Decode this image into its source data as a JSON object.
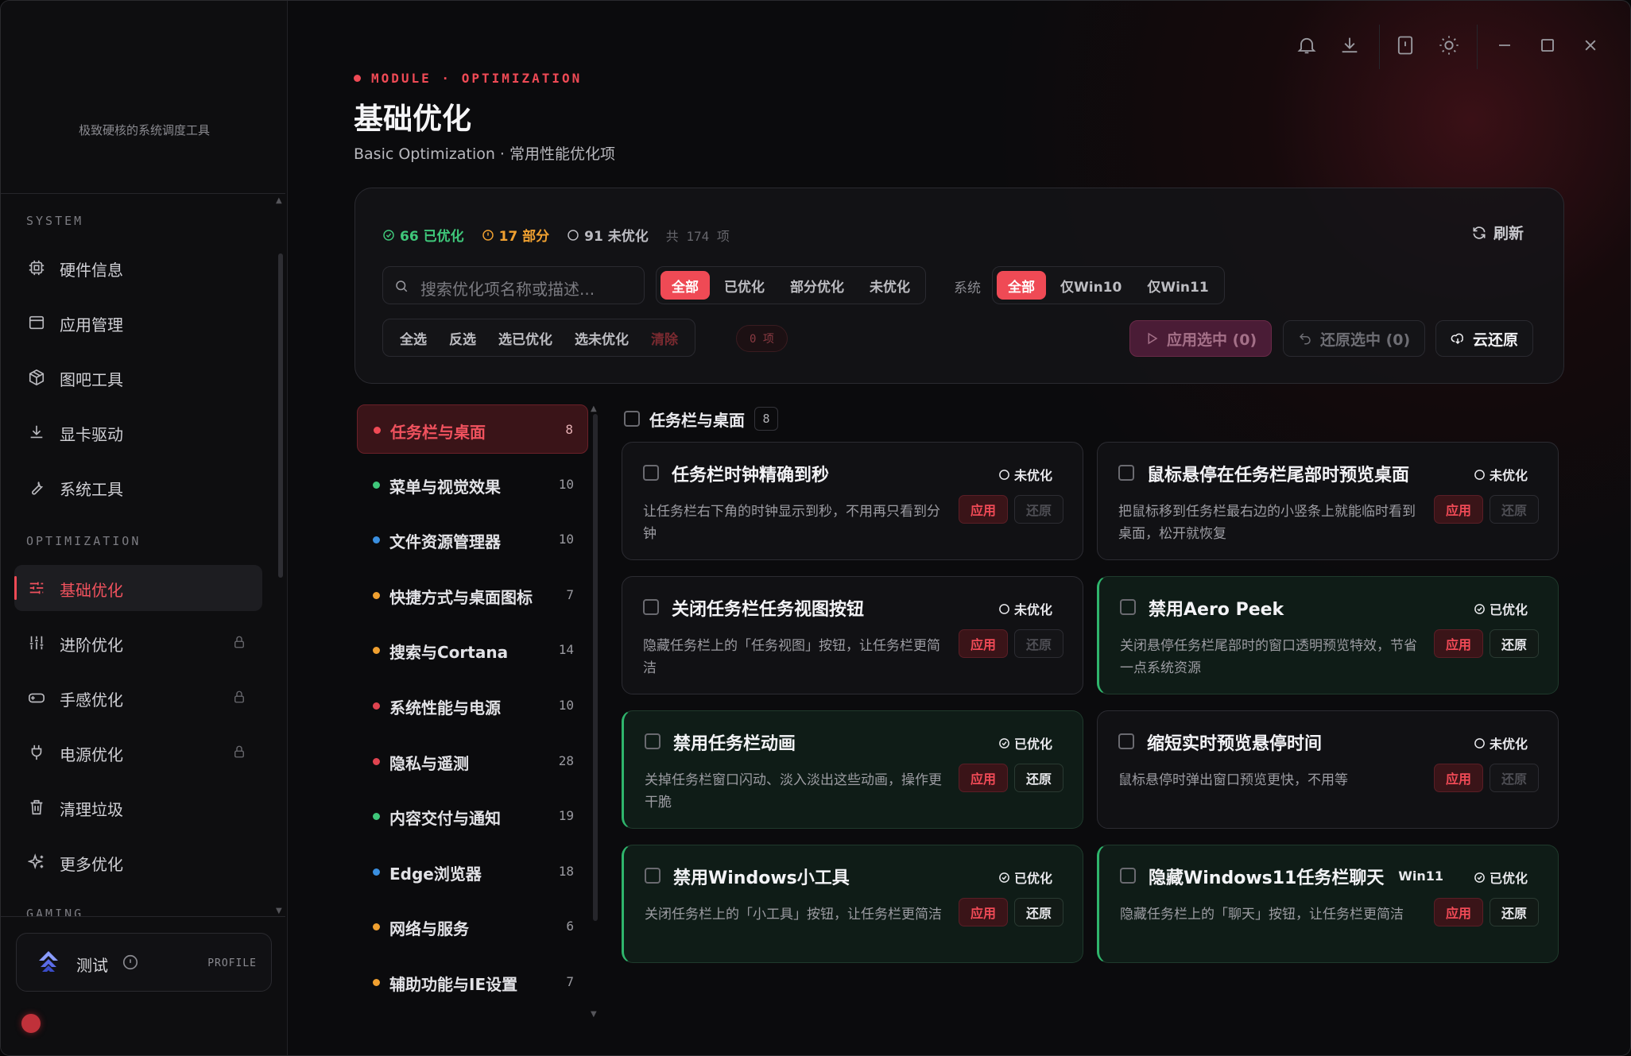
{
  "sidebar": {
    "tagline": "极致硬核的系统调度工具",
    "sections": {
      "system": "SYSTEM",
      "optimization": "OPTIMIZATION",
      "gaming": "GAMING"
    },
    "items": [
      {
        "label": "硬件信息",
        "icon": "cpu-icon"
      },
      {
        "label": "应用管理",
        "icon": "window-icon"
      },
      {
        "label": "图吧工具",
        "icon": "package-icon"
      },
      {
        "label": "显卡驱动",
        "icon": "download-icon"
      },
      {
        "label": "系统工具",
        "icon": "wrench-icon"
      },
      {
        "label": "基础优化",
        "icon": "sliders-icon",
        "active": true
      },
      {
        "label": "进阶优化",
        "icon": "sliders-vertical-icon",
        "locked": true
      },
      {
        "label": "手感优化",
        "icon": "gamepad-icon",
        "locked": true
      },
      {
        "label": "电源优化",
        "icon": "plug-icon",
        "locked": true
      },
      {
        "label": "清理垃圾",
        "icon": "trash-icon"
      },
      {
        "label": "更多优化",
        "icon": "sparkles-icon"
      }
    ],
    "profile": {
      "name": "测试",
      "tag": "PROFILE"
    }
  },
  "header": {
    "module": "MODULE · OPTIMIZATION",
    "title": "基础优化",
    "subtitle": "Basic Optimization · 常用性能优化项"
  },
  "stats": {
    "optimized": "66 已优化",
    "partial": "17 部分",
    "unoptimized": "91 未优化",
    "total": "共 174 项"
  },
  "toolbar": {
    "refresh": "刷新",
    "search_placeholder": "搜索优化项名称或描述...",
    "status_filters": [
      "全部",
      "已优化",
      "部分优化",
      "未优化"
    ],
    "system_label": "系统",
    "system_filters": [
      "全部",
      "仅Win10",
      "仅Win11"
    ],
    "select_actions": [
      "全选",
      "反选",
      "选已优化",
      "选未优化",
      "清除"
    ],
    "selected_count": "0 项",
    "apply_selected": "应用选中 (0)",
    "restore_selected": "还原选中 (0)",
    "cloud_restore": "云还原"
  },
  "categories": [
    {
      "name": "任务栏与桌面",
      "count": "8",
      "color": "#ef4a55",
      "active": true
    },
    {
      "name": "菜单与视觉效果",
      "count": "10",
      "color": "#3fc77a"
    },
    {
      "name": "文件资源管理器",
      "count": "10",
      "color": "#3a8fe0"
    },
    {
      "name": "快捷方式与桌面图标",
      "count": "7",
      "color": "#f0a030"
    },
    {
      "name": "搜索与Cortana",
      "count": "14",
      "color": "#f0a030"
    },
    {
      "name": "系统性能与电源",
      "count": "10",
      "color": "#e04450"
    },
    {
      "name": "隐私与遥测",
      "count": "28",
      "color": "#e04450"
    },
    {
      "name": "内容交付与通知",
      "count": "19",
      "color": "#3fc77a"
    },
    {
      "name": "Edge浏览器",
      "count": "18",
      "color": "#3a8fe0"
    },
    {
      "name": "网络与服务",
      "count": "6",
      "color": "#f0a030"
    },
    {
      "name": "辅助功能与IE设置",
      "count": "7",
      "color": "#f0a030"
    }
  ],
  "group": {
    "title": "任务栏与桌面",
    "count": "8"
  },
  "cards": [
    {
      "title": "任务栏时钟精确到秒",
      "status": "未优化",
      "done": false,
      "desc": "让任务栏右下角的时钟显示到秒，不用再只看到分钟",
      "apply": "应用",
      "restore": "还原"
    },
    {
      "title": "鼠标悬停在任务栏尾部时预览桌面",
      "status": "未优化",
      "done": false,
      "desc": "把鼠标移到任务栏最右边的小竖条上就能临时看到桌面，松开就恢复",
      "apply": "应用",
      "restore": "还原"
    },
    {
      "title": "关闭任务栏任务视图按钮",
      "status": "未优化",
      "done": false,
      "desc": "隐藏任务栏上的「任务视图」按钮，让任务栏更简洁",
      "apply": "应用",
      "restore": "还原"
    },
    {
      "title": "禁用Aero Peek",
      "status": "已优化",
      "done": true,
      "desc": "关闭悬停任务栏尾部时的窗口透明预览特效，节省一点系统资源",
      "apply": "应用",
      "restore": "还原"
    },
    {
      "title": "禁用任务栏动画",
      "status": "已优化",
      "done": true,
      "desc": "关掉任务栏窗口闪动、淡入淡出这些动画，操作更干脆",
      "apply": "应用",
      "restore": "还原"
    },
    {
      "title": "缩短实时预览悬停时间",
      "status": "未优化",
      "done": false,
      "desc": "鼠标悬停时弹出窗口预览更快，不用等",
      "apply": "应用",
      "restore": "还原"
    },
    {
      "title": "禁用Windows小工具",
      "status": "已优化",
      "done": true,
      "desc": "关闭任务栏上的「小工具」按钮，让任务栏更简洁",
      "apply": "应用",
      "restore": "还原"
    },
    {
      "title": "隐藏Windows11任务栏聊天",
      "status": "已优化",
      "done": true,
      "badge": "Win11",
      "desc": "隐藏任务栏上的「聊天」按钮，让任务栏更简洁",
      "apply": "应用",
      "restore": "还原"
    }
  ]
}
